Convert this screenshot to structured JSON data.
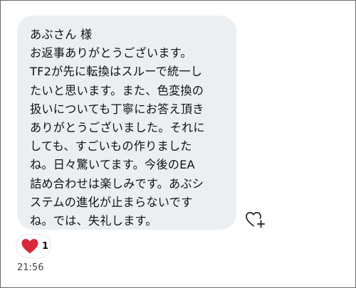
{
  "message": {
    "lines": [
      "あぶさん 様",
      "お返事ありがとうございます。",
      "TF2が先に転換はスルーで統一し",
      "たいと思います。また、色変換の",
      "扱いについても丁寧にお答え頂き",
      "ありがとうございました。それに",
      "しても、すごいもの作りました",
      "ね。日々驚いてます。今後のEA",
      "詰め合わせは楽しみです。あぶシ",
      "ステムの進化が止まらないです",
      "ね。では、失礼します。"
    ],
    "bubble_color": "#eceff2"
  },
  "reaction": {
    "icon": "heart-icon",
    "count": "1",
    "color": "#d8283a"
  },
  "add_reaction": {
    "icon": "heart-plus-icon"
  },
  "timestamp": "21:56"
}
